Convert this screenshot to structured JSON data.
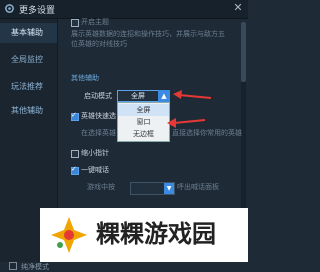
{
  "window": {
    "title": "更多设置",
    "close_icon": "close-icon"
  },
  "sidebar": {
    "items": [
      {
        "label": "基本辅助",
        "active": true
      },
      {
        "label": "全局监控",
        "active": false
      },
      {
        "label": "玩法推荐",
        "active": false
      },
      {
        "label": "其他辅助",
        "active": false
      }
    ],
    "footer_label": "纯净模式"
  },
  "content": {
    "top_checkbox_label": "开启主题",
    "desc1": "展示英雄数据的连招和操作技巧，并展示与敌方五",
    "desc2": "位英雄的对线技巧",
    "section_title": "其他辅助",
    "launch_mode_label": "启动模式",
    "launch_mode": {
      "selected": "全屏",
      "options": [
        "全屏",
        "窗口",
        "无边框"
      ]
    },
    "quick_change_label": "英雄快速选",
    "quick_desc": "在选择英雄",
    "quick_desc_tail": "直接选择你常用的英雄",
    "minimap_label": "缩小指针",
    "one_key_label": "一键喊话",
    "game_hint_label": "游戏中按",
    "game_hint_tail": "呼出喊话面板",
    "dropdown_value": "",
    "accent": "#3c8be3"
  },
  "watermark": {
    "text": "粿粿游戏园"
  }
}
